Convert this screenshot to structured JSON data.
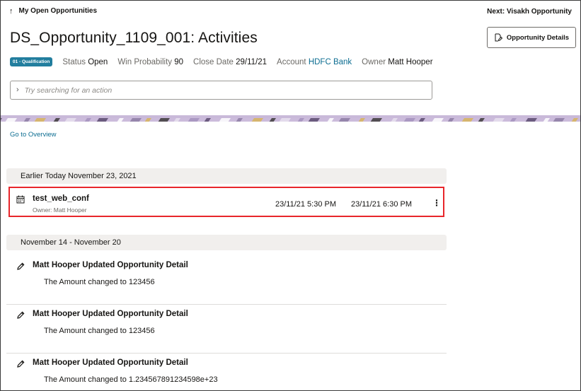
{
  "nav": {
    "back_label": "My Open Opportunities",
    "next_label": "Next: Visakh Opportunity"
  },
  "header": {
    "title": "DS_Opportunity_1109_001: Activities",
    "details_button": "Opportunity Details"
  },
  "meta": {
    "stage_badge": "01 - Qualification",
    "status_label": "Status",
    "status_value": "Open",
    "win_label": "Win Probability",
    "win_value": "90",
    "close_label": "Close Date",
    "close_value": "29/11/21",
    "account_label": "Account",
    "account_value": "HDFC Bank",
    "owner_label": "Owner",
    "owner_value": "Matt Hooper"
  },
  "search": {
    "placeholder": "Try searching for an action"
  },
  "overview_link": "Go to Overview",
  "sections": {
    "today": "Earlier Today November 23, 2021",
    "week": "November 14 - November 20"
  },
  "meeting": {
    "title": "test_web_conf",
    "owner": "Owner: Matt Hooper",
    "start": "23/11/21 5:30 PM",
    "end": "23/11/21 6:30 PM"
  },
  "updates": [
    {
      "title": "Matt Hooper Updated Opportunity Detail",
      "desc": "The Amount changed to 123456"
    },
    {
      "title": "Matt Hooper Updated Opportunity Detail",
      "desc": "The Amount changed to 123456"
    },
    {
      "title": "Matt Hooper Updated Opportunity Detail",
      "desc": "The Amount changed to 1.234567891234598e+23"
    }
  ],
  "icons": {
    "back": "arrow-up-icon",
    "details": "edit-document-icon",
    "search": "chevron-right-icon",
    "meeting": "calendar-icon",
    "more": "more-vertical-icon",
    "update": "pencil-icon"
  },
  "colors": {
    "accent_link": "#0c6d91",
    "badge": "#227e9e",
    "highlight_border": "#e8262b",
    "section_bg": "#f1efed"
  }
}
